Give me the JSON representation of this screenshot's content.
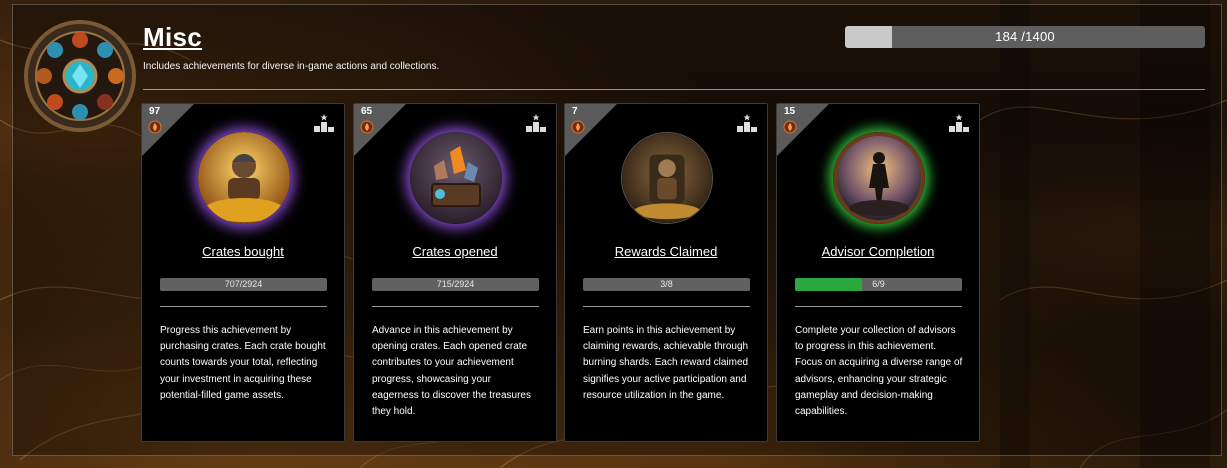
{
  "section": {
    "title": "Misc",
    "subtitle": "Includes achievements for diverse in-game actions and collections.",
    "emblem_icon": "gem-wheel-emblem-icon"
  },
  "total_progress": {
    "text": "184 /1400",
    "current": 184,
    "max": 1400
  },
  "colors": {
    "progress_fill": "#29a83e",
    "progress_track": "#5f6163",
    "corner_badge": "#5a5a5a"
  },
  "cards": [
    {
      "points": "97",
      "title": "Crates bought",
      "progress_text": "707/2924",
      "progress_fraction": 0.0,
      "art_icon": "gold-dwarf-treasure-icon",
      "art_glow": "#8e4fd8",
      "description": "Progress this achievement by purchasing crates. Each crate bought counts towards your total, reflecting your investment in acquiring these potential-filled game assets."
    },
    {
      "points": "65",
      "title": "Crates opened",
      "progress_text": "715/2924",
      "progress_fraction": 0.0,
      "art_icon": "open-crate-crystals-icon",
      "art_glow": "#8e4fd8",
      "description": "Advance in this achievement by opening crates. Each opened crate contributes to your achievement progress, showcasing your eagerness to discover the treasures they hold."
    },
    {
      "points": "7",
      "title": "Rewards Claimed",
      "progress_text": "3/8",
      "progress_fraction": 0.0,
      "art_icon": "seated-king-treasure-icon",
      "art_glow": "#444444",
      "description": "Earn points in this achievement by claiming rewards, achievable through burning shards. Each reward claimed signifies your active participation and resource utilization in the game."
    },
    {
      "points": "15",
      "title": "Advisor Completion",
      "progress_text": "6/9",
      "progress_fraction": 0.4,
      "art_icon": "warrior-silhouette-icon",
      "art_glow": "#2fbf3a",
      "description": "Complete your collection of advisors to progress in this achievement. Focus on acquiring a diverse range of advisors, enhancing your strategic gameplay and decision-making capabilities."
    }
  ]
}
